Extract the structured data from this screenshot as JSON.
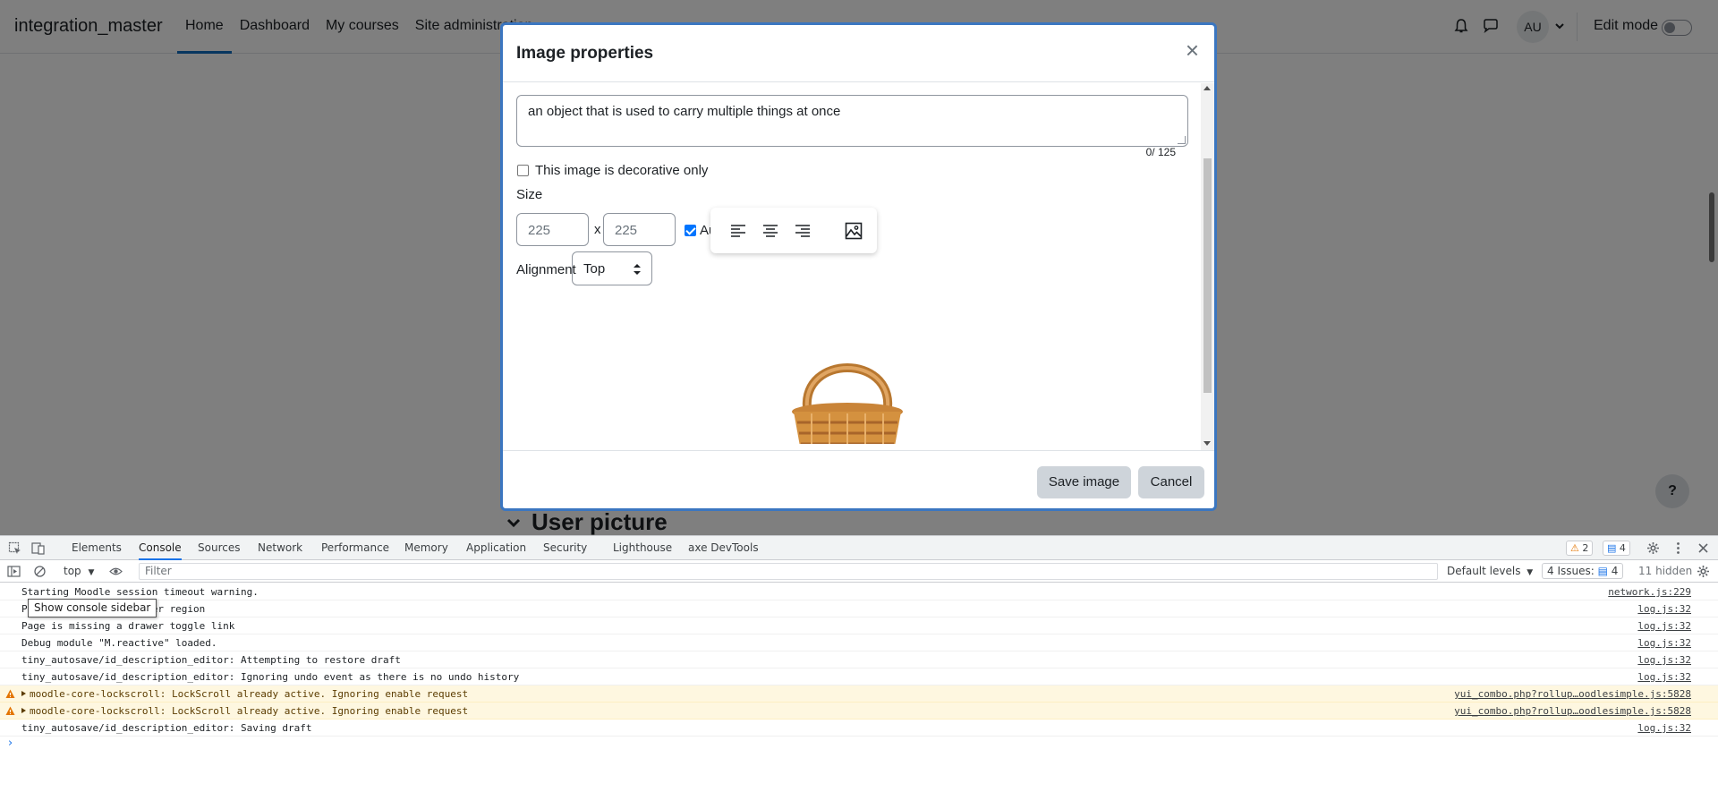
{
  "navbar": {
    "brand": "integration_master",
    "links": [
      "Home",
      "Dashboard",
      "My courses",
      "Site administration"
    ],
    "avatar_initials": "AU",
    "edit_mode_label": "Edit mode"
  },
  "page": {
    "section_title": "User picture",
    "help_label": "?"
  },
  "modal": {
    "title": "Image properties",
    "close_glyph": "×",
    "alt_text_value": "an object that is used to carry multiple things at once",
    "char_count": "0/ 125",
    "decorative_label": "This image is decorative only",
    "decorative_checked": false,
    "size_label": "Size",
    "width_value": "225",
    "height_value": "225",
    "size_separator": "x",
    "auto_label": "Au",
    "auto_checked": true,
    "alignment_label": "Alignment",
    "alignment_value": "Top",
    "toolbar_icons": [
      "align-left-icon",
      "align-center-icon",
      "align-right-icon",
      "image-icon"
    ],
    "save_label": "Save image",
    "cancel_label": "Cancel"
  },
  "devtools": {
    "tabs": [
      "Elements",
      "Console",
      "Sources",
      "Network",
      "Performance",
      "Memory",
      "Application",
      "Security",
      "Lighthouse",
      "axe DevTools"
    ],
    "active_tab": "Console",
    "warning_count": "2",
    "message_count": "4",
    "context": "top",
    "filter_placeholder": "Filter",
    "default_levels": "Default levels",
    "issues_label": "4 Issues:",
    "issues_count": "4",
    "hidden_label": "11 hidden",
    "tooltip": "Show console sidebar",
    "logs": [
      {
        "msg": "Starting Moodle session timeout warning.",
        "src": "network.js:229",
        "level": "info"
      },
      {
        "msg": "Page is missing a drawer region",
        "src": "log.js:32",
        "level": "info"
      },
      {
        "msg": "Page is missing a drawer toggle link",
        "src": "log.js:32",
        "level": "info"
      },
      {
        "msg": "Debug module \"M.reactive\" loaded.",
        "src": "log.js:32",
        "level": "info"
      },
      {
        "msg": "tiny_autosave/id_description_editor: Attempting to restore draft",
        "src": "log.js:32",
        "level": "info"
      },
      {
        "msg": "tiny_autosave/id_description_editor: Ignoring undo event as there is no undo history",
        "src": "log.js:32",
        "level": "info"
      },
      {
        "msg": "moodle-core-lockscroll: LockScroll already active. Ignoring enable request",
        "src": "yui_combo.php?rollup…oodlesimple.js:5828",
        "level": "warn"
      },
      {
        "msg": "moodle-core-lockscroll: LockScroll already active. Ignoring enable request",
        "src": "yui_combo.php?rollup…oodlesimple.js:5828",
        "level": "warn"
      },
      {
        "msg": "tiny_autosave/id_description_editor: Saving draft",
        "src": "log.js:32",
        "level": "info"
      }
    ],
    "prompt": "›"
  }
}
